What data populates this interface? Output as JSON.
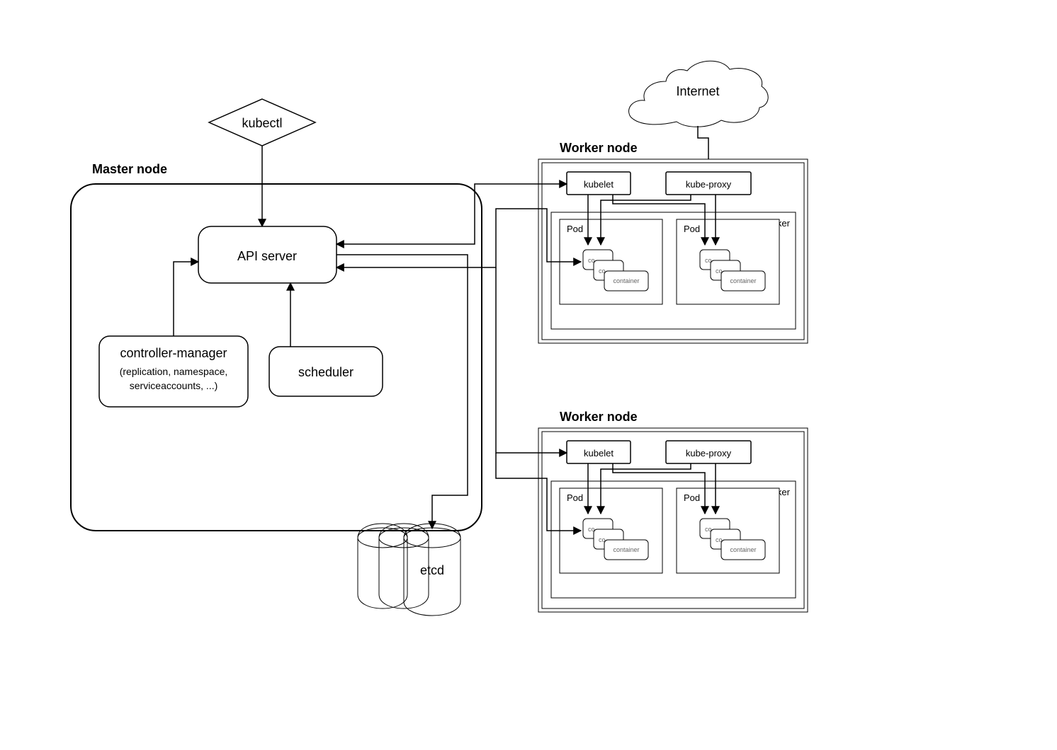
{
  "internet": "Internet",
  "kubectl": "kubectl",
  "master": {
    "title": "Master node",
    "api": "API server",
    "controller_title": "controller-manager",
    "controller_sub1": "(replication, namespace,",
    "controller_sub2": "serviceaccounts, ...)",
    "scheduler": "scheduler",
    "etcd": "etcd"
  },
  "worker": {
    "title": "Worker node",
    "kubelet": "kubelet",
    "kubeproxy": "kube-proxy",
    "docker": "docker",
    "pod": "Pod",
    "container": "container",
    "co": "co"
  }
}
